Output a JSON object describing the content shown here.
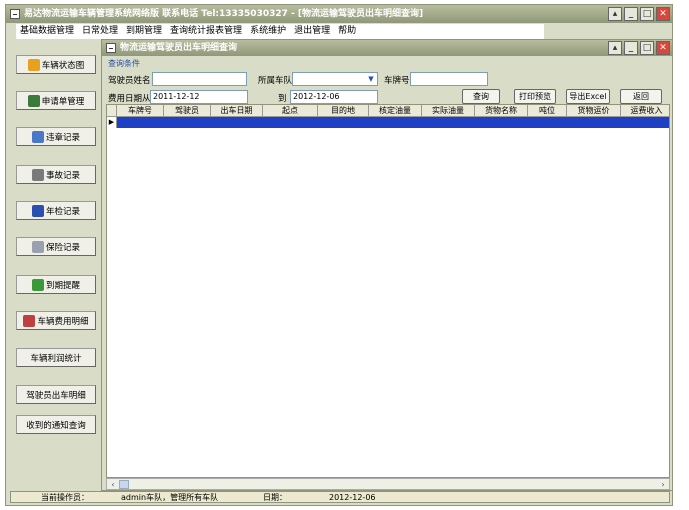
{
  "window": {
    "title": "易达物流运输车辆管理系统网络版 联系电话 Tel:13335030327 - [物流运输驾驶员出车明细查询]"
  },
  "menu": [
    "基础数据管理",
    "日常处理",
    "到期管理",
    "查询统计报表管理",
    "系统维护",
    "退出管理",
    "帮助"
  ],
  "sidebar": [
    {
      "label": "车辆状态图",
      "icon": "vehicle-status-icon",
      "color": "#e8a020"
    },
    {
      "label": "申请单管理",
      "icon": "application-icon",
      "color": "#3a7a3a"
    },
    {
      "label": "违章记录",
      "icon": "violation-icon",
      "color": "#4a78c8"
    },
    {
      "label": "事故记录",
      "icon": "accident-icon",
      "color": "#7a7a7a"
    },
    {
      "label": "年检记录",
      "icon": "inspection-icon",
      "color": "#2a4fb0"
    },
    {
      "label": "保险记录",
      "icon": "insurance-icon",
      "color": "#9aa0b0"
    },
    {
      "label": "到期提醒",
      "icon": "reminder-icon",
      "color": "#3a9a3a"
    },
    {
      "label": "车辆费用明细",
      "icon": "expense-icon",
      "color": "#c04040"
    },
    {
      "label": "车辆利润统计",
      "icon": "",
      "color": ""
    },
    {
      "label": "驾驶员出车明细",
      "icon": "",
      "color": ""
    },
    {
      "label": "收到的通知查询",
      "icon": "",
      "color": ""
    }
  ],
  "inner": {
    "title": "物流运输驾驶员出车明细查询"
  },
  "query": {
    "section_label": "查询条件",
    "driver_label": "驾驶员姓名",
    "driver_value": "",
    "team_label": "所属车队",
    "team_value": "",
    "plate_label": "车牌号",
    "plate_value": "",
    "date_from_label": "费用日期从",
    "date_from": "2011-12-12",
    "date_to_label": "到",
    "date_to": "2012-12-06",
    "search": "查询",
    "print_preview": "打印预览",
    "export_excel": "导出Excel",
    "back": "返回"
  },
  "table": {
    "columns": [
      "车牌号",
      "驾驶员",
      "出车日期",
      "起点",
      "目的地",
      "核定油量",
      "实际油量",
      "货物名称",
      "吨位",
      "货物运价",
      "运费收入"
    ],
    "rows": []
  },
  "status": {
    "operator_label": "当前操作员：",
    "operator": "admin车队，管理所有车队",
    "date_label": "日期：",
    "date": "2012-12-06"
  }
}
